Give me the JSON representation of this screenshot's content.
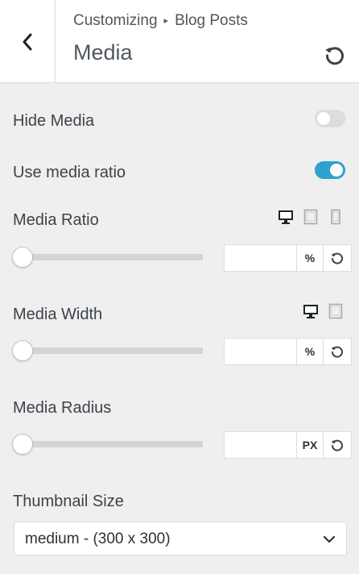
{
  "header": {
    "breadcrumb_parent": "Customizing",
    "breadcrumb_separator": "▸",
    "breadcrumb_section": "Blog Posts",
    "title": "Media",
    "back_icon": "chevron-left-icon",
    "reset_icon": "undo-icon"
  },
  "hide_media": {
    "label": "Hide Media",
    "enabled": false
  },
  "use_media_ratio": {
    "label": "Use media ratio",
    "enabled": true
  },
  "media_ratio": {
    "label": "Media Ratio",
    "devices": [
      "desktop",
      "tablet",
      "mobile"
    ],
    "active_device": "desktop",
    "value": "",
    "unit": "%",
    "slider_level": 0
  },
  "media_width": {
    "label": "Media Width",
    "devices": [
      "desktop",
      "tablet"
    ],
    "active_device": "desktop",
    "value": "",
    "unit": "%",
    "slider_level": 0
  },
  "media_radius": {
    "label": "Media Radius",
    "value": "",
    "unit": "PX",
    "slider_level": 0
  },
  "thumbnail_size": {
    "label": "Thumbnail Size",
    "selected": "medium - (300 x 300)"
  },
  "colors": {
    "accent": "#2ea2cc",
    "panel_bg": "#efefef",
    "header_bg": "#ffffff",
    "text": "#3c434a"
  }
}
